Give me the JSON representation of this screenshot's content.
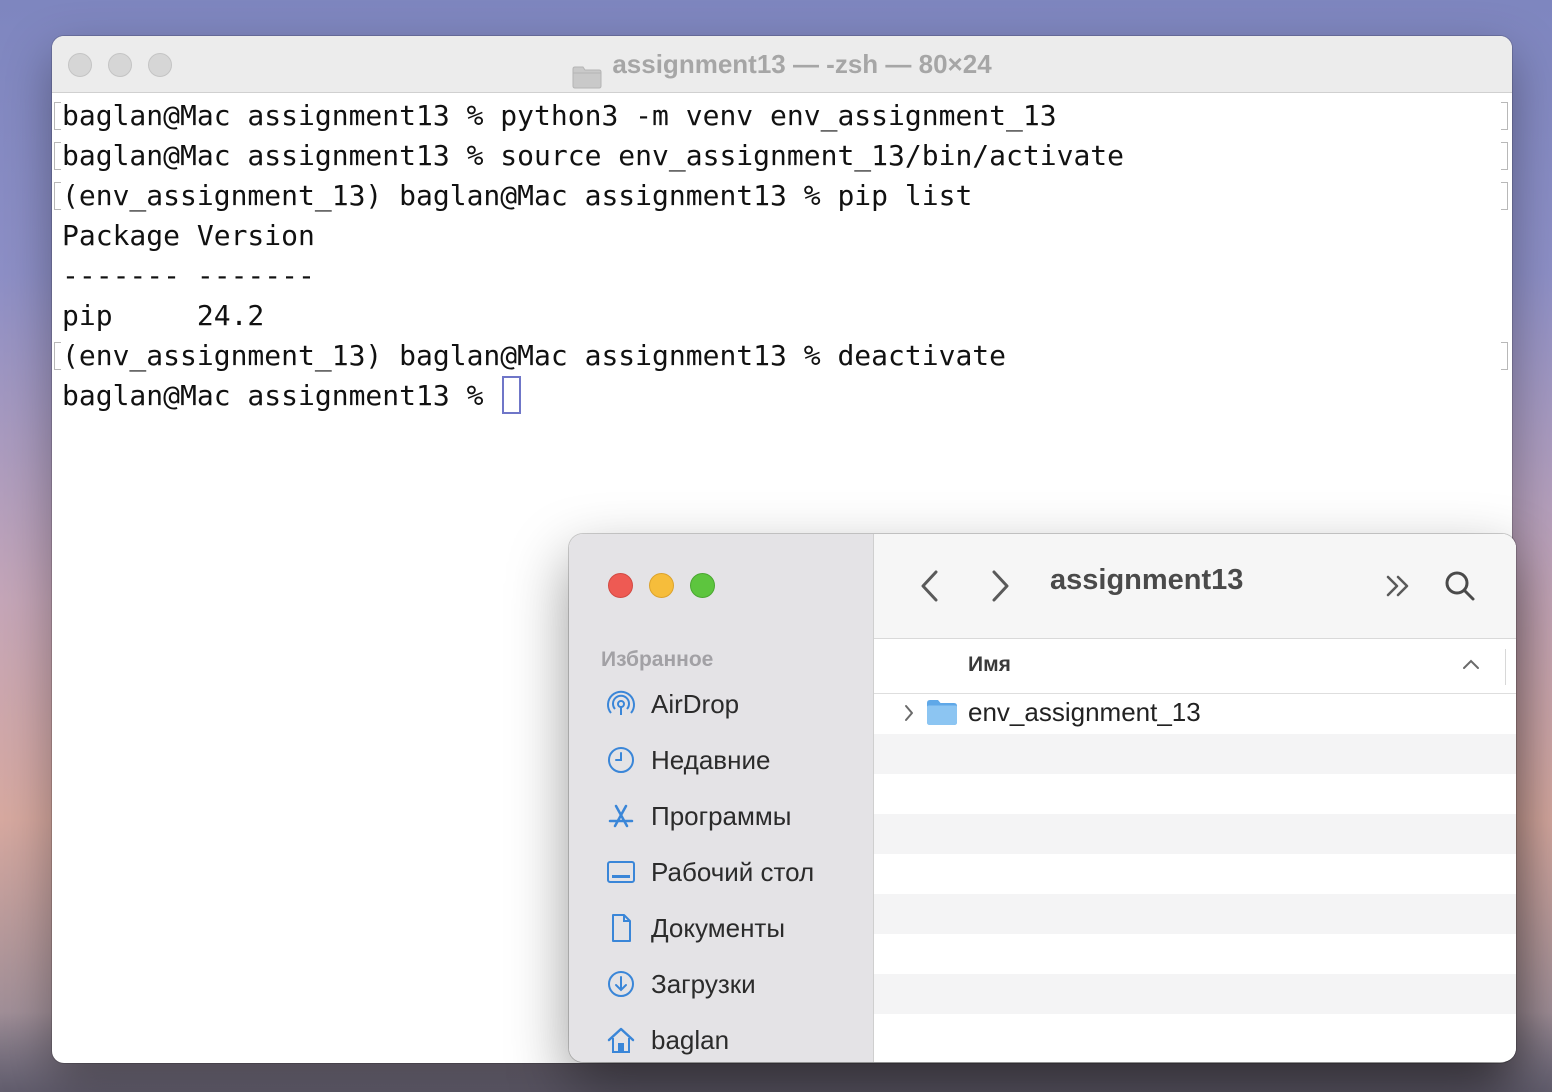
{
  "terminal": {
    "title": "assignment13 — -zsh — 80×24",
    "lines": [
      "baglan@Mac assignment13 % python3 -m venv env_assignment_13",
      "baglan@Mac assignment13 % source env_assignment_13/bin/activate",
      "(env_assignment_13) baglan@Mac assignment13 % pip list",
      "Package Version",
      "------- -------",
      "pip     24.2",
      "(env_assignment_13) baglan@Mac assignment13 % deactivate",
      "baglan@Mac assignment13 % "
    ]
  },
  "finder": {
    "title": "assignment13",
    "sidebar": {
      "section": "Избранное",
      "items": [
        {
          "label": "AirDrop",
          "icon": "airdrop-icon"
        },
        {
          "label": "Недавние",
          "icon": "clock-icon"
        },
        {
          "label": "Программы",
          "icon": "apps-icon"
        },
        {
          "label": "Рабочий стол",
          "icon": "desktop-icon"
        },
        {
          "label": "Документы",
          "icon": "document-icon"
        },
        {
          "label": "Загрузки",
          "icon": "downloads-icon"
        },
        {
          "label": "baglan",
          "icon": "home-icon"
        }
      ]
    },
    "column_header": "Имя",
    "files": [
      {
        "name": "env_assignment_13",
        "type": "folder"
      }
    ]
  },
  "colors": {
    "accent": "#3a86d8",
    "cursor": "#6f76c8"
  }
}
